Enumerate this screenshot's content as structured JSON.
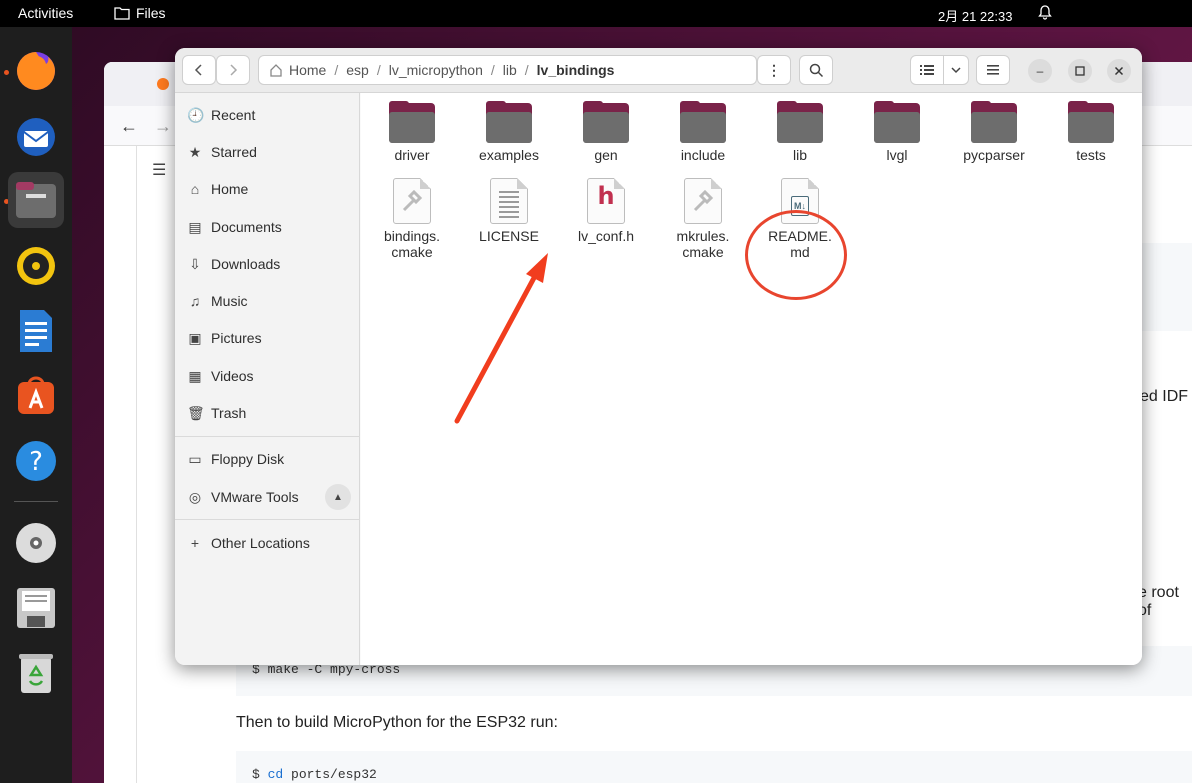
{
  "topbar": {
    "activities": "Activities",
    "app_name": "Files",
    "clock": "2月 21  22:33"
  },
  "dock": {
    "apps": [
      "firefox-icon",
      "thunderbird-icon",
      "files-icon",
      "rhythmbox-icon",
      "libreoffice-writer-icon",
      "app-center-icon",
      "help-icon",
      "dvd-icon",
      "floppy-icon",
      "trash-icon"
    ]
  },
  "background_page": {
    "code1": "$ make -C mpy-cross",
    "para1": "Then to build MicroPython for the ESP32 run:",
    "code2_prefix": "$ ",
    "code2_cmd": "cd",
    "code2_rest": " ports/esp32",
    "fragment_right1": "ed IDF",
    "fragment_right2": "e root of"
  },
  "files": {
    "path": {
      "home": "Home",
      "segments": [
        "esp",
        "lv_micropython",
        "lib"
      ],
      "current": "lv_bindings"
    },
    "sidebar": {
      "items": [
        {
          "label": "Recent",
          "icon": "clock-icon"
        },
        {
          "label": "Starred",
          "icon": "star-icon"
        },
        {
          "label": "Home",
          "icon": "home-icon"
        },
        {
          "label": "Documents",
          "icon": "document-icon"
        },
        {
          "label": "Downloads",
          "icon": "download-icon"
        },
        {
          "label": "Music",
          "icon": "music-icon"
        },
        {
          "label": "Pictures",
          "icon": "picture-icon"
        },
        {
          "label": "Videos",
          "icon": "video-icon"
        },
        {
          "label": "Trash",
          "icon": "trash-icon"
        }
      ],
      "devices": [
        {
          "label": "Floppy Disk"
        },
        {
          "label": "VMware Tools"
        }
      ],
      "other": "Other Locations"
    },
    "folders": [
      "driver",
      "examples",
      "gen",
      "include",
      "lib",
      "lvgl",
      "pycparser",
      "tests"
    ],
    "files": [
      {
        "name_line1": "bindings.",
        "name_line2": "cmake",
        "kind": "script"
      },
      {
        "name_line1": "LICENSE",
        "name_line2": "",
        "kind": "text"
      },
      {
        "name_line1": "lv_conf.h",
        "name_line2": "",
        "kind": "header"
      },
      {
        "name_line1": "mkrules.",
        "name_line2": "cmake",
        "kind": "script"
      },
      {
        "name_line1": "README.",
        "name_line2": "md",
        "kind": "markdown"
      }
    ],
    "header_glyph": "h",
    "markdown_glyph": "M↓"
  },
  "colors": {
    "annotation_red": "#e8452e",
    "folder_tab": "#7a2349",
    "folder_body": "#6d6d6d",
    "accent": "#e95420"
  }
}
